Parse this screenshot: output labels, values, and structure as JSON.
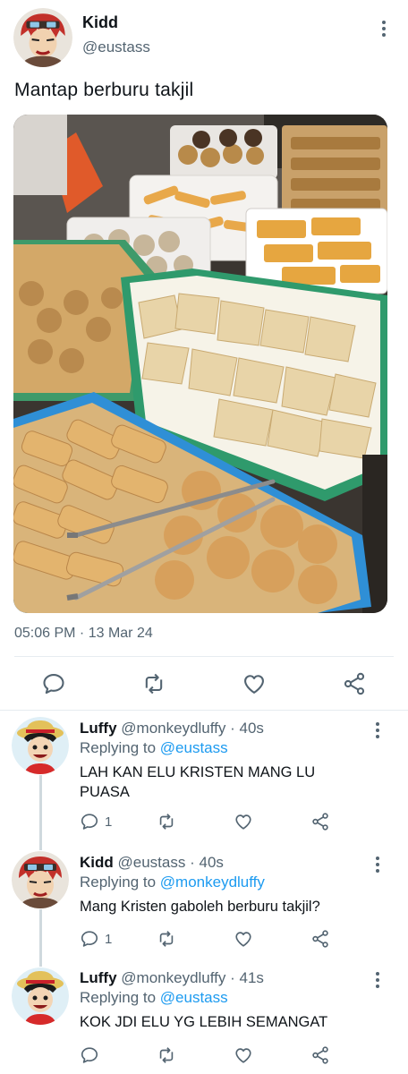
{
  "main_tweet": {
    "author_name": "Kidd",
    "author_handle": "@eustass",
    "text": "Mantap berburu takjil",
    "timestamp": "05:06 PM · 13 Mar 24",
    "photo_description": "tray-of-fried-snacks"
  },
  "replies": [
    {
      "name": "Luffy",
      "handle": "@monkeydluffy",
      "time": "· 40s",
      "replying_label": "Replying to",
      "replying_to": "@eustass",
      "text": "LAH KAN ELU KRISTEN MANG LU PUASA",
      "reply_count": "1"
    },
    {
      "name": "Kidd",
      "handle": "@eustass",
      "time": "· 40s",
      "replying_label": "Replying to",
      "replying_to": "@monkeydluffy",
      "text": "Mang Kristen gaboleh berburu takjil?",
      "reply_count": "1"
    },
    {
      "name": "Luffy",
      "handle": "@monkeydluffy",
      "time": "· 41s",
      "replying_label": "Replying to",
      "replying_to": "@eustass",
      "text": "KOK JDI ELU YG LEBIH SEMANGAT",
      "reply_count": ""
    }
  ],
  "colors": {
    "accent": "#1d9bf0",
    "secondary_text": "#536471",
    "primary_text": "#0f1419",
    "divider": "#e6ecf0"
  }
}
